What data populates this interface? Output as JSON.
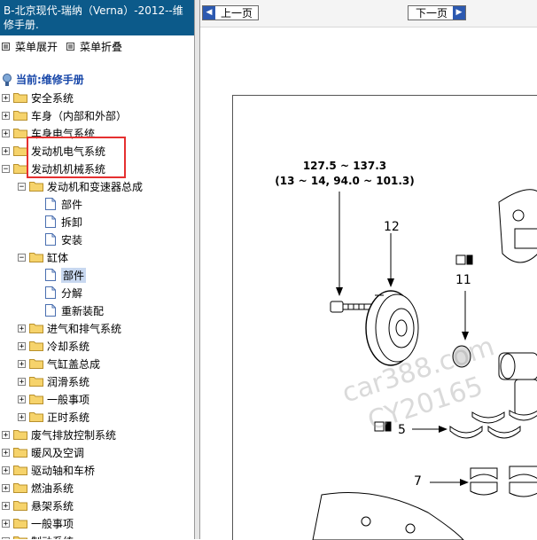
{
  "left_panel": {
    "title": "B-北京现代-瑞纳（Verna）-2012--维修手册.",
    "expand_all": "菜单展开",
    "collapse_all": "菜单折叠",
    "current": "当前:维修手册"
  },
  "tree": [
    {
      "label": "安全系统",
      "level": 0,
      "toggle": "+",
      "kind": "folder"
    },
    {
      "label": "车身（内部和外部）",
      "level": 0,
      "toggle": "+",
      "kind": "folder"
    },
    {
      "label": "车身电气系统",
      "level": 0,
      "toggle": "+",
      "kind": "folder"
    },
    {
      "label": "发动机电气系统",
      "level": 0,
      "toggle": "+",
      "kind": "folder"
    },
    {
      "label": "发动机机械系统",
      "level": 0,
      "toggle": "-",
      "kind": "folder"
    },
    {
      "label": "发动机和变速器总成",
      "level": 1,
      "toggle": "-",
      "kind": "folder"
    },
    {
      "label": "部件",
      "level": 2,
      "toggle": "",
      "kind": "doc"
    },
    {
      "label": "拆卸",
      "level": 2,
      "toggle": "",
      "kind": "doc"
    },
    {
      "label": "安装",
      "level": 2,
      "toggle": "",
      "kind": "doc"
    },
    {
      "label": "缸体",
      "level": 1,
      "toggle": "-",
      "kind": "folder"
    },
    {
      "label": "部件",
      "level": 2,
      "toggle": "",
      "kind": "doc",
      "selected": true
    },
    {
      "label": "分解",
      "level": 2,
      "toggle": "",
      "kind": "doc"
    },
    {
      "label": "重新装配",
      "level": 2,
      "toggle": "",
      "kind": "doc"
    },
    {
      "label": "进气和排气系统",
      "level": 1,
      "toggle": "+",
      "kind": "folder"
    },
    {
      "label": "冷却系统",
      "level": 1,
      "toggle": "+",
      "kind": "folder"
    },
    {
      "label": "气缸盖总成",
      "level": 1,
      "toggle": "+",
      "kind": "folder"
    },
    {
      "label": "润滑系统",
      "level": 1,
      "toggle": "+",
      "kind": "folder"
    },
    {
      "label": "一般事项",
      "level": 1,
      "toggle": "+",
      "kind": "folder"
    },
    {
      "label": "正时系统",
      "level": 1,
      "toggle": "+",
      "kind": "folder"
    },
    {
      "label": "废气排放控制系统",
      "level": 0,
      "toggle": "+",
      "kind": "folder"
    },
    {
      "label": "暖风及空调",
      "level": 0,
      "toggle": "+",
      "kind": "folder"
    },
    {
      "label": "驱动轴和车桥",
      "level": 0,
      "toggle": "+",
      "kind": "folder"
    },
    {
      "label": "燃油系统",
      "level": 0,
      "toggle": "+",
      "kind": "folder"
    },
    {
      "label": "悬架系统",
      "level": 0,
      "toggle": "+",
      "kind": "folder"
    },
    {
      "label": "一般事项",
      "level": 0,
      "toggle": "+",
      "kind": "folder"
    },
    {
      "label": "制动系统",
      "level": 0,
      "toggle": "+",
      "kind": "folder"
    }
  ],
  "nav": {
    "prev": "上一页",
    "next": "下一页"
  },
  "diagram": {
    "torque_line1": "127.5 ~ 137.3",
    "torque_line2": "(13 ~ 14, 94.0 ~ 101.3)",
    "label_12": "12",
    "label_11": "11",
    "label_5": "5",
    "label_7": "7",
    "watermark_1": "car388.com",
    "watermark_2": "CY20165"
  }
}
